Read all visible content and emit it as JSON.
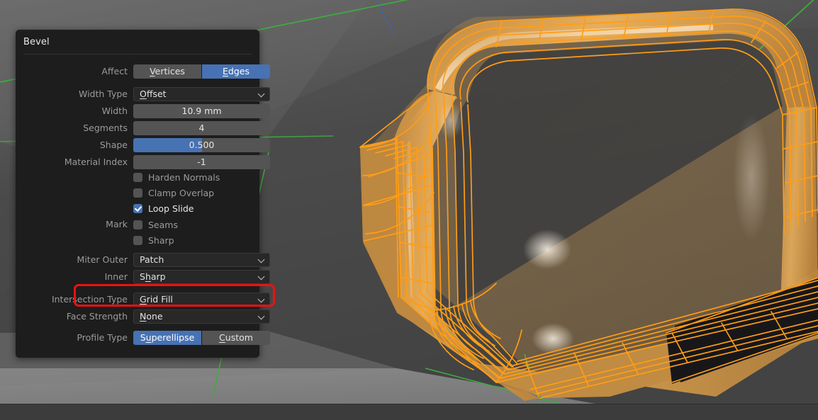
{
  "app": {
    "viewport_background": "#3d3d3d",
    "mesh_highlight_color": "#f5a623",
    "axis_color_y": "#4aa84a",
    "accent_color": "#4772b3",
    "highlight_box_color": "#ee1111"
  },
  "panel": {
    "title": "Bevel",
    "rows": [
      {
        "kind": "toggle",
        "name": "affect",
        "label": "Affect",
        "options": [
          {
            "label": "Vertices",
            "mnemonic": "V",
            "selected": false
          },
          {
            "label": "Edges",
            "mnemonic": "E",
            "selected": true
          }
        ]
      },
      {
        "kind": "dropdown",
        "name": "width-type",
        "label": "Width Type",
        "value": "Offset",
        "mnemonic": "O"
      },
      {
        "kind": "number",
        "name": "width",
        "label": "Width",
        "value": "10.9 mm",
        "fill_percent": 0
      },
      {
        "kind": "number",
        "name": "segments",
        "label": "Segments",
        "value": "4",
        "fill_percent": 0
      },
      {
        "kind": "number",
        "name": "shape",
        "label": "Shape",
        "value": "0.500",
        "fill_percent": 50
      },
      {
        "kind": "number",
        "name": "material-index",
        "label": "Material Index",
        "value": "-1",
        "fill_percent": 0
      },
      {
        "kind": "checkbox",
        "name": "harden-normals",
        "label": "",
        "text": "Harden Normals",
        "checked": false
      },
      {
        "kind": "checkbox",
        "name": "clamp-overlap",
        "label": "",
        "text": "Clamp Overlap",
        "checked": false
      },
      {
        "kind": "checkbox",
        "name": "loop-slide",
        "label": "",
        "text": "Loop Slide",
        "checked": true
      },
      {
        "kind": "checkbox",
        "name": "mark-seams",
        "label": "Mark",
        "text": "Seams",
        "checked": false
      },
      {
        "kind": "checkbox",
        "name": "mark-sharp",
        "label": "",
        "text": "Sharp",
        "checked": false
      },
      {
        "kind": "dropdown",
        "name": "miter-outer",
        "label": "Miter Outer",
        "value": "Patch",
        "mnemonic": "",
        "highlighted": true
      },
      {
        "kind": "dropdown",
        "name": "miter-inner",
        "label": "Inner",
        "value": "Sharp",
        "mnemonic": "h"
      },
      {
        "kind": "dropdown",
        "name": "intersection-type",
        "label": "Intersection Type",
        "value": "Grid Fill",
        "mnemonic": "G"
      },
      {
        "kind": "dropdown",
        "name": "face-strength",
        "label": "Face Strength",
        "value": "None",
        "mnemonic": "N"
      },
      {
        "kind": "toggle",
        "name": "profile-type",
        "label": "Profile Type",
        "options": [
          {
            "label": "Superellipse",
            "mnemonic": "u",
            "selected": true
          },
          {
            "label": "Custom",
            "mnemonic": "C",
            "selected": false
          }
        ]
      }
    ]
  }
}
